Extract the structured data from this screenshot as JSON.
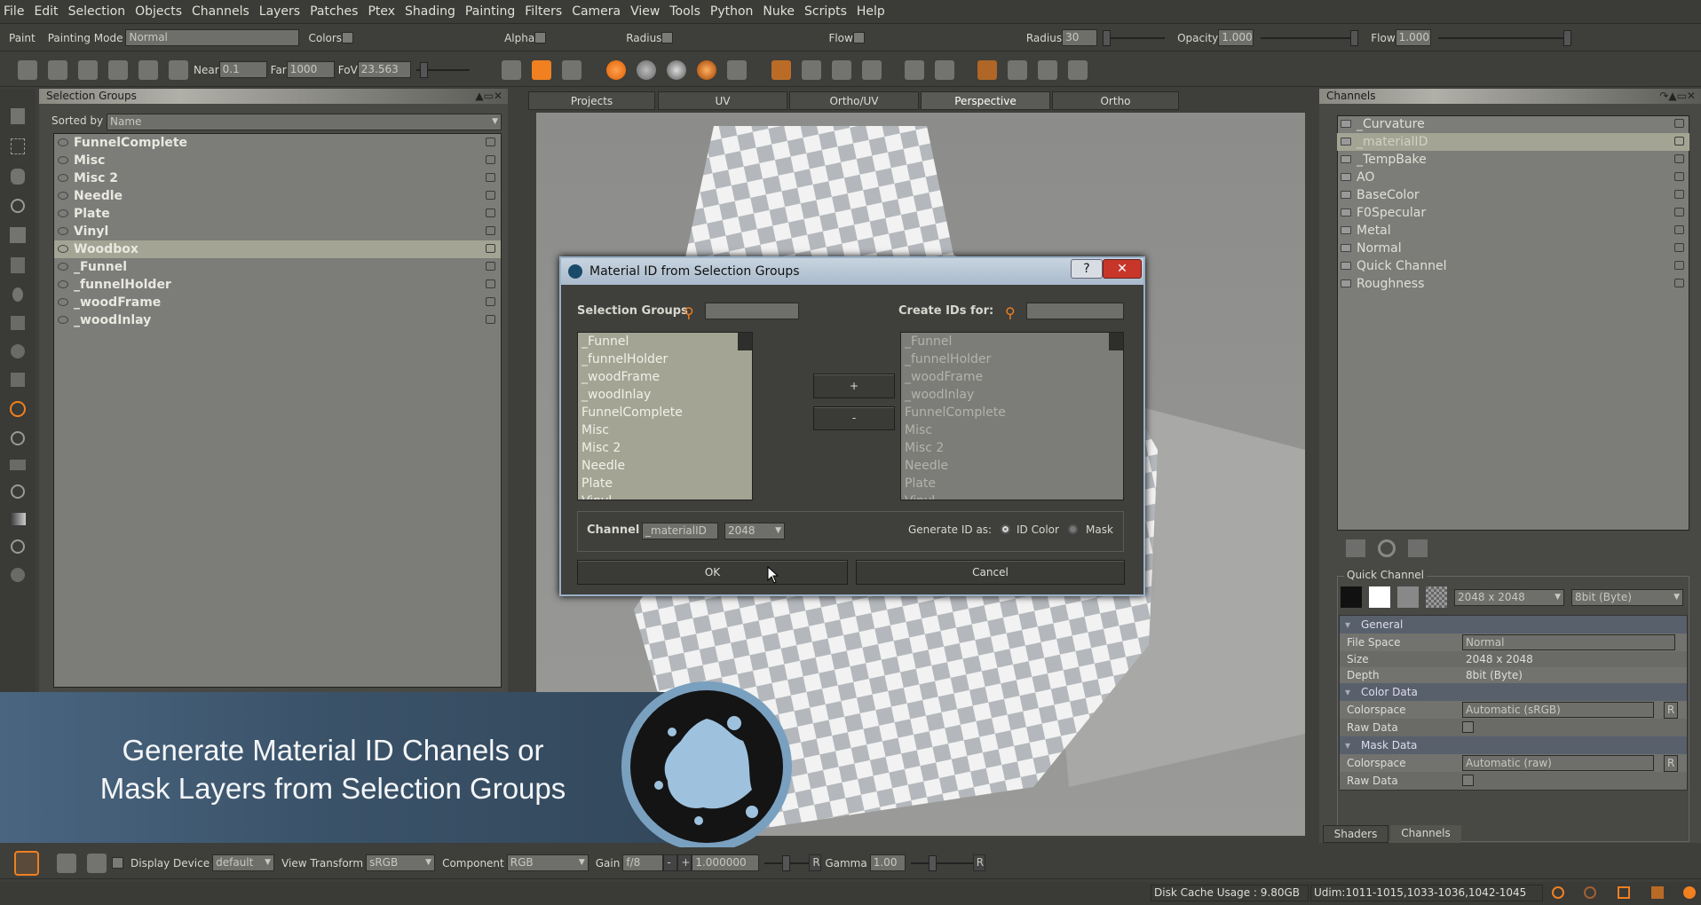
{
  "menu": [
    "File",
    "Edit",
    "Selection",
    "Objects",
    "Channels",
    "Layers",
    "Patches",
    "Ptex",
    "Shading",
    "Painting",
    "Filters",
    "Camera",
    "View",
    "Tools",
    "Python",
    "Nuke",
    "Scripts",
    "Help"
  ],
  "paint_toolbar": {
    "paint": "Paint",
    "painting_mode_label": "Painting Mode",
    "painting_mode": "Normal",
    "colors": "Colors",
    "alpha": "Alpha",
    "radius_chk": "Radius",
    "flow_chk": "Flow",
    "radius_label": "Radius",
    "radius": "30",
    "opacity_label": "Opacity",
    "opacity": "1.000",
    "flow_label": "Flow",
    "flow": "1.000"
  },
  "view_toolbar": {
    "near_label": "Near",
    "near": "0.1",
    "far_label": "Far",
    "far": "1000",
    "fov_label": "FoV",
    "fov": "23.563"
  },
  "selection_groups": {
    "title": "Selection Groups",
    "sorted_by_label": "Sorted by",
    "sorted_by": "Name",
    "items": [
      "FunnelComplete",
      "Misc",
      "Misc 2",
      "Needle",
      "Plate",
      "Vinyl",
      "Woodbox",
      "_Funnel",
      "_funnelHolder",
      "_woodFrame",
      "_woodInlay"
    ],
    "selected": "Woodbox"
  },
  "viewport_tabs": [
    "Projects",
    "UV",
    "Ortho/UV",
    "Perspective",
    "Ortho"
  ],
  "active_tab": "Perspective",
  "dialog": {
    "title": "Material ID from Selection Groups",
    "left_label": "Selection Groups",
    "right_label": "Create IDs for:",
    "left_items": [
      "_Funnel",
      "_funnelHolder",
      "_woodFrame",
      "_woodInlay",
      "FunnelComplete",
      "Misc",
      "Misc 2",
      "Needle",
      "Plate",
      "Vinyl"
    ],
    "right_items": [
      "_Funnel",
      "_funnelHolder",
      "_woodFrame",
      "_woodInlay",
      "FunnelComplete",
      "Misc",
      "Misc 2",
      "Needle",
      "Plate",
      "Vinyl"
    ],
    "add": "+",
    "remove": "-",
    "channel_label": "Channel",
    "channel": "_materialID",
    "resolution": "2048",
    "generate_label": "Generate ID as:",
    "opt_id_color": "ID Color",
    "opt_mask": "Mask",
    "selected_option": "ID Color",
    "ok": "OK",
    "cancel": "Cancel",
    "help": "?"
  },
  "channels": {
    "title": "Channels",
    "items": [
      "_Curvature",
      "_materialID",
      "_TempBake",
      "AO",
      "BaseColor",
      "F0Specular",
      "Metal",
      "Normal",
      "Quick Channel",
      "Roughness"
    ],
    "selected": "_materialID"
  },
  "quick_channel": {
    "title": "Quick Channel",
    "size": "2048 x 2048",
    "depth": "8bit  (Byte)"
  },
  "properties": {
    "general": "General",
    "file_space_label": "File Space",
    "file_space": "Normal",
    "size_label": "Size",
    "size": "2048 x 2048",
    "depth_label": "Depth",
    "depth": "8bit  (Byte)",
    "color_data": "Color Data",
    "colorspace_label": "Colorspace",
    "colorspace": "Automatic (sRGB)",
    "raw_label": "Raw Data",
    "mask_data": "Mask Data",
    "mask_colorspace": "Automatic (raw)",
    "r": "R"
  },
  "right_tabs": [
    "Shaders",
    "Channels"
  ],
  "banner": {
    "line1": "Generate Material ID Chanels or",
    "line2": "Mask Layers from Selection Groups"
  },
  "bottom_toolbar": {
    "display_device_label": "Display Device",
    "display_device": "default",
    "view_transform_label": "View Transform",
    "view_transform": "sRGB",
    "component_label": "Component",
    "component": "RGB",
    "gain_label": "Gain",
    "gain": "f/8",
    "gain_value": "1.000000",
    "gamma_label": "Gamma",
    "gamma": "1.00",
    "minus": "-",
    "plus": "+",
    "r": "R"
  },
  "status": {
    "disk_cache": "Disk Cache Usage : 9.80GB",
    "udim": "Udim:1011-1015,1033-1036,1042-1045"
  },
  "colors": {
    "accent": "#f08020",
    "banner": "#3e5870",
    "selection": "#a4a494"
  }
}
